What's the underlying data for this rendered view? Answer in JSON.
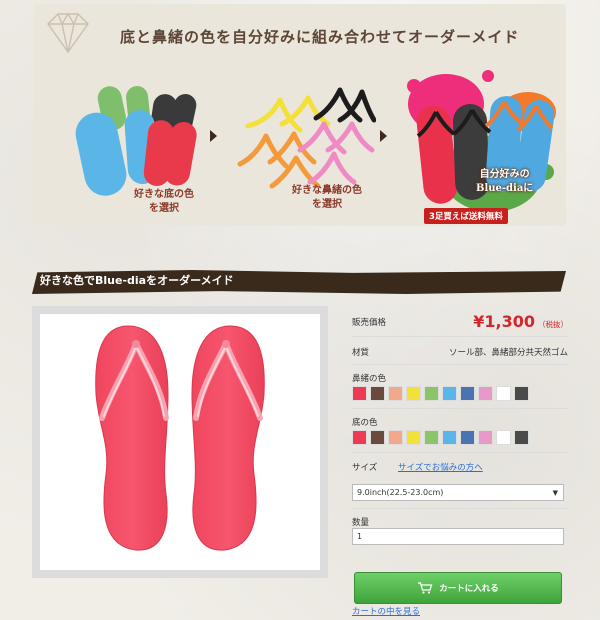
{
  "banner": {
    "title": "底と鼻緒の色を自分好みに組み合わせてオーダーメイド",
    "step1_caption": [
      "好きな底の色",
      "を選択"
    ],
    "step2_caption": [
      "好きな鼻緒の色",
      "を選択"
    ],
    "step3_caption": [
      "自分好みの",
      "Blue-diaに"
    ],
    "promo": "3足買えば送料無料"
  },
  "section": {
    "title": "好きな色でBlue-diaをオーダーメイド"
  },
  "panel": {
    "price_label": "販売価格",
    "price": "¥1,300",
    "tax_note": "（税抜）",
    "material_label": "材質",
    "material_value": "ソール部、鼻緒部分共天然ゴム",
    "strap_label": "鼻緒の色",
    "sole_label": "底の色",
    "size_label": "サイズ",
    "size_link": "サイズでお悩みの方へ",
    "size_selected": "9.0inch(22.5-23.0cm)",
    "qty_label": "数量",
    "qty_value": "1",
    "cart_button": "カートに入れる",
    "cart_link": "カートの中を見る"
  },
  "colors": {
    "strap": [
      "#ee3b54",
      "#6b4a3e",
      "#f2a98a",
      "#f3e13a",
      "#8ac56a",
      "#5ab6e6",
      "#4a74b0",
      "#e79ac8",
      "#ffffff",
      "#4a4a4a"
    ],
    "sole": [
      "#ee3b54",
      "#6b4a3e",
      "#f2a98a",
      "#f3e13a",
      "#8ac56a",
      "#5ab6e6",
      "#4a74b0",
      "#e79ac8",
      "#ffffff",
      "#4a4a4a"
    ],
    "price": "#d2262e",
    "button": "#4cb847",
    "product": "#f3546a"
  }
}
